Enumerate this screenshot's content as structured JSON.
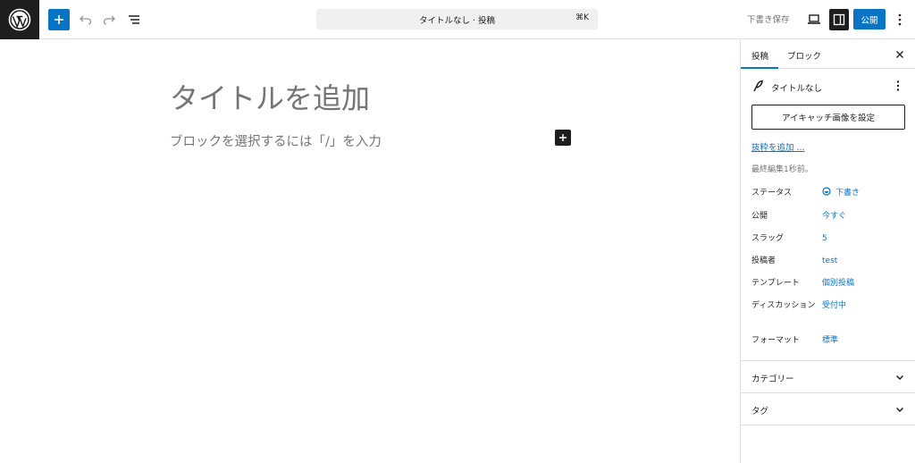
{
  "toolbar": {
    "command_title": "タイトルなし · 投稿",
    "command_shortcut": "⌘K",
    "save_draft": "下書き保存",
    "publish": "公開"
  },
  "canvas": {
    "title_placeholder": "タイトルを追加",
    "block_placeholder": "ブロックを選択するには「/」を入力"
  },
  "sidebar": {
    "tabs": [
      {
        "label": "投稿"
      },
      {
        "label": "ブロック"
      }
    ],
    "post_name": "タイトルなし",
    "featured_image_button": "アイキャッチ画像を設定",
    "excerpt_link": "抜粋を追加 ...",
    "last_edited": "最終編集1秒前。",
    "meta": [
      {
        "label": "ステータス",
        "value": "下書き"
      },
      {
        "label": "公開",
        "value": "今すぐ"
      },
      {
        "label": "スラッグ",
        "value": "5"
      },
      {
        "label": "投稿者",
        "value": "test"
      },
      {
        "label": "テンプレート",
        "value": "個別投稿"
      },
      {
        "label": "ディスカッション",
        "value": "受付中"
      },
      {
        "label": "フォーマット",
        "value": "標準"
      }
    ],
    "panels": [
      {
        "title": "カテゴリー"
      },
      {
        "title": "タグ"
      }
    ]
  },
  "colors": {
    "accent": "#0a74c4",
    "dark": "#1e1e1e",
    "muted": "#757575",
    "border": "#e0e0e0"
  }
}
